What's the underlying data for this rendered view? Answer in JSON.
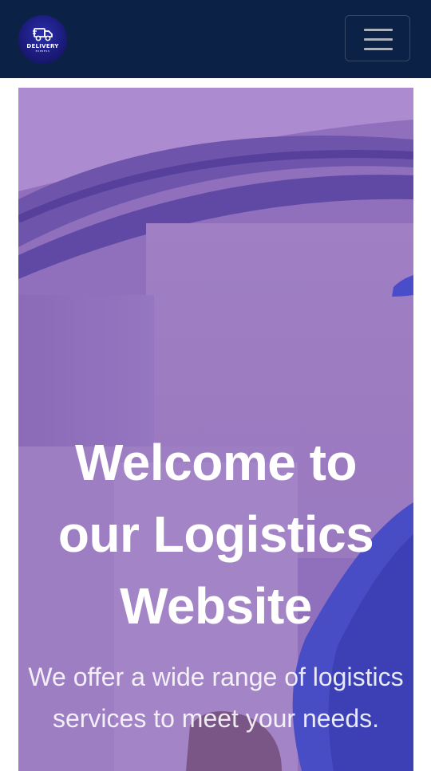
{
  "navbar": {
    "logo": {
      "icon": "truck-icon",
      "word": "DELIVERY",
      "sub": "EXPRESS"
    },
    "menu_icon": "hamburger-menu-icon"
  },
  "hero": {
    "title": "Welcome to our Logistics Website",
    "subtitle": "We offer a wide range of logistics services to meet your needs."
  },
  "colors": {
    "navbar_bg": "#0b2146",
    "hero_overlay": "#9a7cc0",
    "text": "#ffffff"
  }
}
